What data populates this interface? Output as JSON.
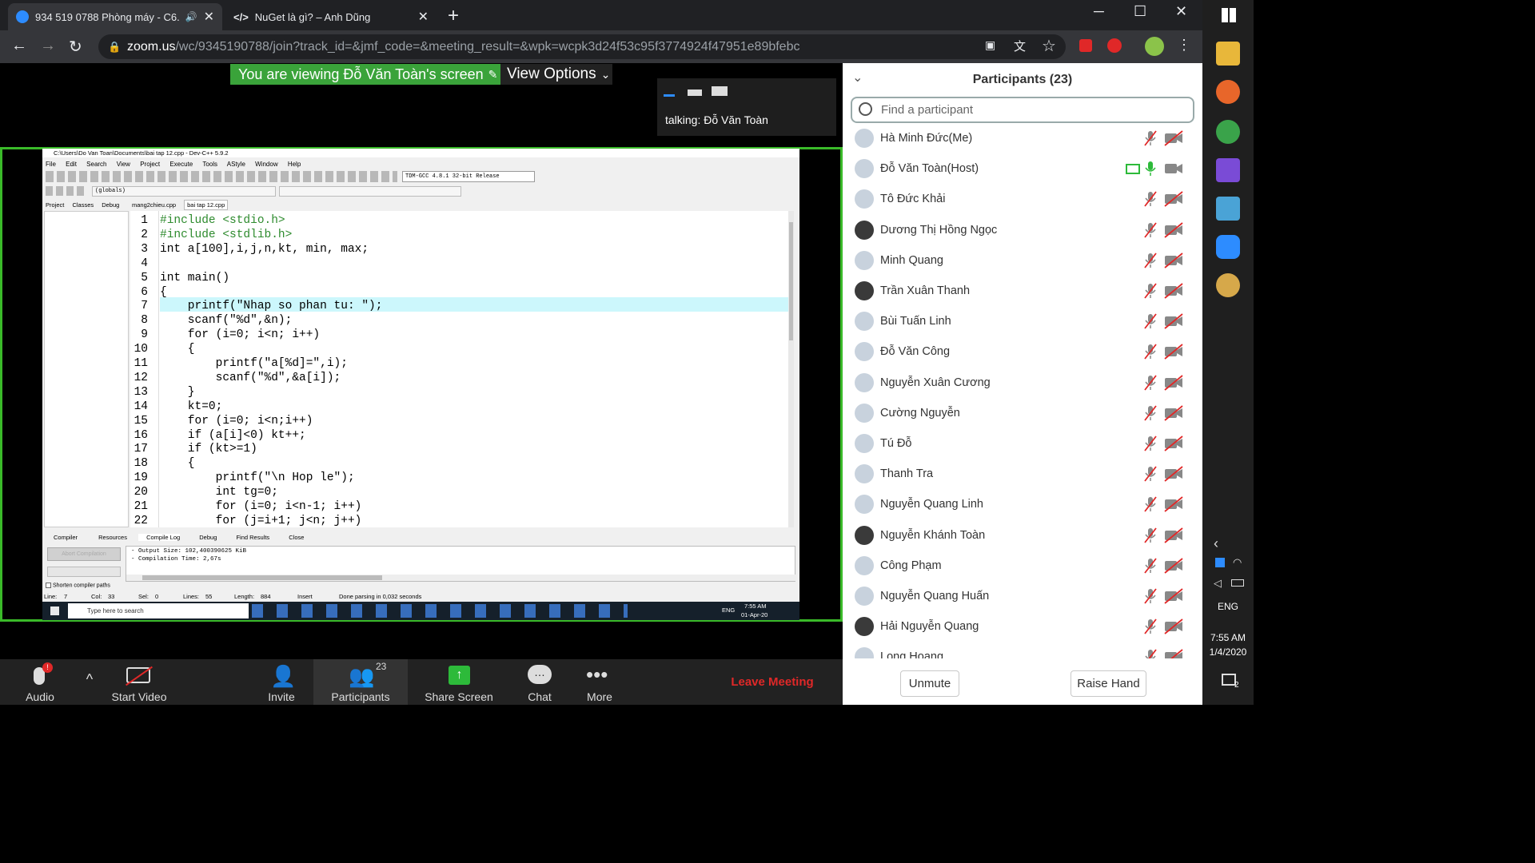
{
  "browser": {
    "tabs": [
      {
        "title": "934 519 0788 Phòng máy - C6.",
        "icon": "zoom-icon",
        "active": true
      },
      {
        "title": "NuGet là gì? – Anh Dũng",
        "icon": "code-icon",
        "active": false
      }
    ],
    "url_domain": "zoom.us",
    "url_rest": "/wc/9345190788/join?track_id=&jmf_code=&meeting_result=&wpk=wcpk3d24f53c95f3774924f47951e89bfebc"
  },
  "meeting": {
    "banner_text": "You are viewing Đỗ Văn Toàn's screen",
    "view_options_label": "View Options",
    "talking_label": "talking:",
    "talking_name": "Đỗ Văn Toàn"
  },
  "devcpp": {
    "title": "C:\\Users\\Do Van Toan\\Documents\\bai tap 12.cpp - Dev-C++ 5.9.2",
    "menu": [
      "File",
      "Edit",
      "Search",
      "View",
      "Project",
      "Execute",
      "Tools",
      "AStyle",
      "Window",
      "Help"
    ],
    "compiler_select": "TDM-GCC 4.8.1 32-bit Release",
    "globals_select": "(globals)",
    "left_tabs": [
      "Project",
      "Classes",
      "Debug"
    ],
    "file_tabs": [
      "mang2chieu.cpp",
      "bai tap 12.cpp"
    ],
    "code_lines": [
      {
        "n": "1",
        "code": "#include <stdio.h>",
        "type": "pre"
      },
      {
        "n": "2",
        "code": "#include <stdlib.h>",
        "type": "pre"
      },
      {
        "n": "3",
        "code": "int a[100],i,j,n,kt, min, max;",
        "type": "plain"
      },
      {
        "n": "4",
        "code": "",
        "type": "plain"
      },
      {
        "n": "5",
        "code": "int main()",
        "type": "plain"
      },
      {
        "n": "6",
        "code": "{",
        "type": "plain"
      },
      {
        "n": "7",
        "code": "    printf(\"Nhap so phan tu: \");",
        "type": "plain"
      },
      {
        "n": "8",
        "code": "    scanf(\"%d\",&n);",
        "type": "plain"
      },
      {
        "n": "9",
        "code": "    for (i=0; i<n; i++)",
        "type": "plain"
      },
      {
        "n": "10",
        "code": "    {",
        "type": "plain"
      },
      {
        "n": "11",
        "code": "        printf(\"a[%d]=\",i);",
        "type": "plain"
      },
      {
        "n": "12",
        "code": "        scanf(\"%d\",&a[i]);",
        "type": "plain"
      },
      {
        "n": "13",
        "code": "    }",
        "type": "plain"
      },
      {
        "n": "14",
        "code": "    kt=0;",
        "type": "plain"
      },
      {
        "n": "15",
        "code": "    for (i=0; i<n;i++)",
        "type": "plain"
      },
      {
        "n": "16",
        "code": "    if (a[i]<0) kt++;",
        "type": "plain"
      },
      {
        "n": "17",
        "code": "    if (kt>=1)",
        "type": "plain"
      },
      {
        "n": "18",
        "code": "    {",
        "type": "plain"
      },
      {
        "n": "19",
        "code": "        printf(\"\\n Hop le\");",
        "type": "plain"
      },
      {
        "n": "20",
        "code": "        int tg=0;",
        "type": "plain"
      },
      {
        "n": "21",
        "code": "        for (i=0; i<n-1; i++)",
        "type": "plain"
      },
      {
        "n": "22",
        "code": "        for (j=i+1; j<n; j++)",
        "type": "plain"
      }
    ],
    "bottom_tabs": [
      "Compiler",
      "Resources",
      "Compile Log",
      "Debug",
      "Find Results",
      "Close"
    ],
    "abort_button": "Abort Compilation",
    "log_lines": [
      "- Output Size: 102,400390625 KiB",
      "- Compilation Time: 2,67s"
    ],
    "shorten_label": "Shorten compiler paths",
    "status": {
      "line": "Line:",
      "line_v": "7",
      "col": "Col:",
      "col_v": "33",
      "sel": "Sel:",
      "sel_v": "0",
      "lines": "Lines:",
      "lines_v": "55",
      "length": "Length:",
      "length_v": "884",
      "mode": "Insert",
      "msg": "Done parsing in 0,032 seconds"
    },
    "taskbar": {
      "search": "Type here to search",
      "lang": "ENG",
      "time": "7:55 AM",
      "date": "01-Apr-20"
    }
  },
  "participants_panel": {
    "title": "Participants (23)",
    "search_placeholder": "Find a participant",
    "list": [
      {
        "name": "Hà Minh Đức(Me)",
        "mic": "muted",
        "video": "off"
      },
      {
        "name": "Đỗ Văn Toàn(Host)",
        "mic": "on",
        "video": "on",
        "sharing": true
      },
      {
        "name": "Tô Đức Khải",
        "mic": "muted",
        "video": "off"
      },
      {
        "name": "Dương Thị Hồng Ngọc",
        "mic": "muted",
        "video": "off"
      },
      {
        "name": "Minh Quang",
        "mic": "muted",
        "video": "off"
      },
      {
        "name": "Trần Xuân Thanh",
        "mic": "muted",
        "video": "off"
      },
      {
        "name": "Bùi Tuấn Linh",
        "mic": "muted",
        "video": "off"
      },
      {
        "name": "Đỗ Văn Công",
        "mic": "muted",
        "video": "off"
      },
      {
        "name": "Nguyễn Xuân Cương",
        "mic": "muted",
        "video": "off"
      },
      {
        "name": "Cường Nguyễn",
        "mic": "muted",
        "video": "off"
      },
      {
        "name": "Tú Đỗ",
        "mic": "muted",
        "video": "off"
      },
      {
        "name": "Thanh Tra",
        "mic": "muted",
        "video": "off"
      },
      {
        "name": "Nguyễn Quang Linh",
        "mic": "muted",
        "video": "off"
      },
      {
        "name": "Nguyễn Khánh Toàn",
        "mic": "muted",
        "video": "off"
      },
      {
        "name": "Công Phạm",
        "mic": "muted",
        "video": "off"
      },
      {
        "name": "Nguyễn Quang Huấn",
        "mic": "muted",
        "video": "off"
      },
      {
        "name": "Hải Nguyễn Quang",
        "mic": "muted",
        "video": "off"
      },
      {
        "name": "Long Hoang",
        "mic": "muted",
        "video": "off"
      }
    ],
    "unmute_label": "Unmute",
    "raise_hand_label": "Raise Hand"
  },
  "toolbar": {
    "audio_label": "Audio",
    "audio_badge": "!",
    "start_video_label": "Start Video",
    "invite_label": "Invite",
    "participants_label": "Participants",
    "participants_count": "23",
    "share_screen_label": "Share Screen",
    "chat_label": "Chat",
    "more_label": "More",
    "leave_label": "Leave Meeting"
  },
  "windows": {
    "lang": "ENG",
    "time": "7:55 AM",
    "date": "1/4/2020",
    "notif_count": "2"
  },
  "colors": {
    "zoom_green": "#3aa33a",
    "share_border": "#3aba29",
    "leave_red": "#e02828",
    "share_green": "#2dba3a"
  }
}
